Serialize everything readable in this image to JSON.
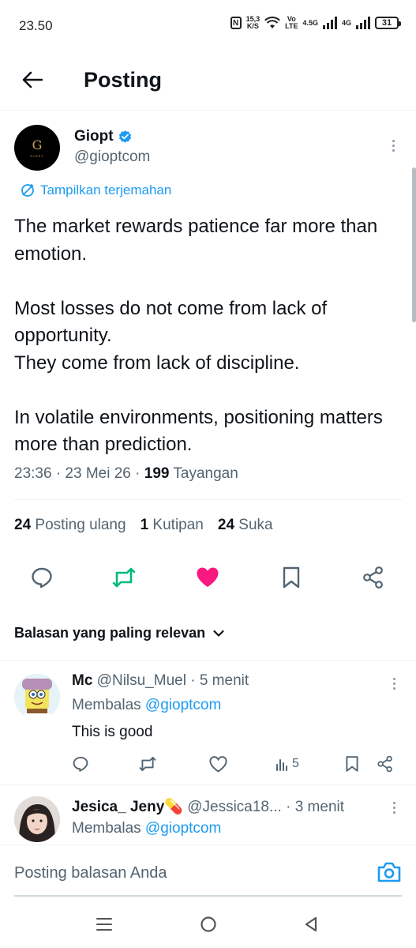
{
  "status_bar": {
    "time": "23.50",
    "network_speed_value": "15,3",
    "network_speed_unit": "K/S",
    "volte_top": "Vo",
    "volte_bottom": "LTE",
    "sim1_label": "4.5G",
    "sim2_label": "4G",
    "battery": "31"
  },
  "header": {
    "title": "Posting"
  },
  "tweet": {
    "author_name": "Giopt",
    "author_handle": "@gioptcom",
    "avatar_letter": "G",
    "avatar_subtext": "GIOPT",
    "translate_label": "Tampilkan terjemahan",
    "text": "The market rewards patience far more than emotion.\n\nMost losses do not come from lack of opportunity.\nThey come from lack of discipline.\n\nIn volatile environments, positioning matters more than prediction.",
    "time": "23:36 · 23 Mei 26 · ",
    "views_count": "199",
    "views_label": " Tayangan",
    "reposts_count": "24",
    "reposts_label": " Posting ulang",
    "quotes_count": "1",
    "quotes_label": " Kutipan",
    "likes_count": "24",
    "likes_label": " Suka",
    "liked": true,
    "reposted": true
  },
  "sort": {
    "label": "Balasan yang paling relevan"
  },
  "replies": [
    {
      "name": "Mc",
      "handle": " @Nilsu_Muel · 5 menit",
      "replying_prefix": "Membalas ",
      "replying_to": "@gioptcom",
      "text": "This is good",
      "views": "5"
    },
    {
      "name": "Jesica_ Jeny💊",
      "handle": " @Jessica18... · 3 menit",
      "replying_prefix": "Membalas ",
      "replying_to": "@gioptcom"
    }
  ],
  "compose": {
    "placeholder": "Posting balasan Anda"
  },
  "colors": {
    "accent": "#1d9bf0",
    "like": "#f91880",
    "repost": "#00ba7c",
    "text": "#0f1419",
    "secondary": "#536471"
  }
}
